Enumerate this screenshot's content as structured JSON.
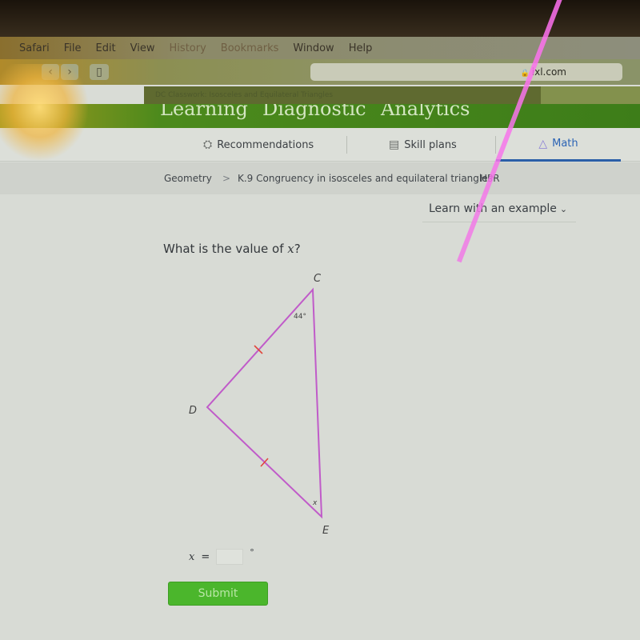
{
  "menubar": {
    "items": [
      "Safari",
      "File",
      "Edit",
      "View",
      "History",
      "Bookmarks",
      "Window",
      "Help"
    ]
  },
  "browser": {
    "url": "ixl.com",
    "tab_title": "DC Classwork: Isosceles and Equilateral Triangles",
    "back_icon": "chevron-left",
    "forward_icon": "chevron-right"
  },
  "top_nav": {
    "items": [
      "Learning",
      "Diagnostic",
      "Analytics"
    ]
  },
  "sub_nav": {
    "items": [
      {
        "label": "Recommendations",
        "icon": "recommendations-icon",
        "active": false
      },
      {
        "label": "Skill plans",
        "icon": "skill-plans-icon",
        "active": false
      },
      {
        "label": "Math",
        "icon": "math-pyramid-icon",
        "active": true
      }
    ]
  },
  "breadcrumb": {
    "subject": "Geometry",
    "separator": ">",
    "skill": "K.9 Congruency in isosceles and equilateral triangles",
    "code": "HPR"
  },
  "learn_example": {
    "label": "Learn with an example",
    "chevron": "⌄"
  },
  "question": {
    "text_prefix": "What is the value of ",
    "variable": "x",
    "text_suffix": "?"
  },
  "figure": {
    "vertices": {
      "C": "C",
      "D": "D",
      "E": "E"
    },
    "angle_C": "44°",
    "angle_E": "x",
    "congruent_sides": [
      "DC",
      "DE"
    ],
    "line_color": "#c05bc9",
    "tick_color": "#e0463c"
  },
  "answer": {
    "label_var": "x",
    "label_eq": "=",
    "value": "",
    "unit": "°"
  },
  "submit": {
    "label": "Submit"
  },
  "colors": {
    "submit_green": "#4bb62c",
    "active_tab_blue": "#2b5fa8",
    "nav_green": "#3d7d19"
  }
}
